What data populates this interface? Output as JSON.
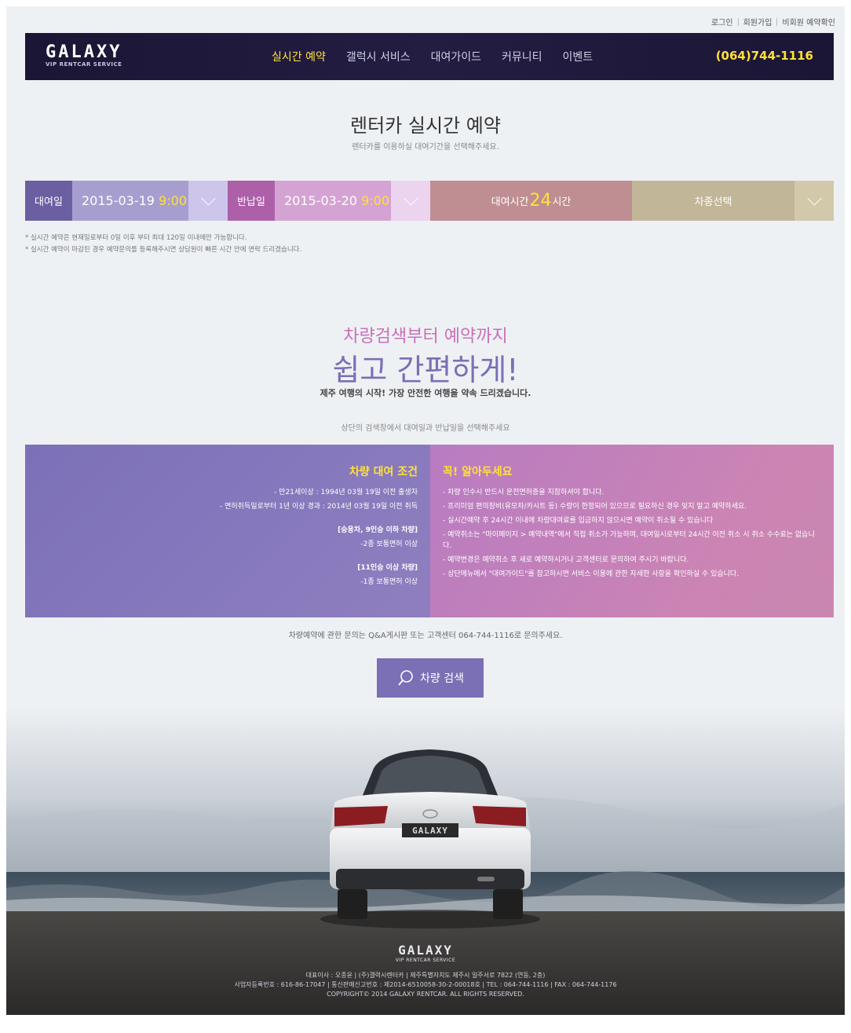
{
  "top_links": [
    "로그인",
    "회원가입",
    "비회원 예약확인"
  ],
  "brand": {
    "name": "GALAXY",
    "sub": "VIP RENTCAR SERVICE"
  },
  "nav": [
    "실시간 예약",
    "갤럭시 서비스",
    "대여가이드",
    "커뮤니티",
    "이벤트"
  ],
  "nav_active_index": 0,
  "phone": "(064)744-1116",
  "reserve": {
    "title": "렌터카 실시간 예약",
    "subtitle": "렌터카를 이용하실 대여기간을 선택해주세요."
  },
  "search": {
    "rental_label": "대여일",
    "rental_date": "2015-03-19",
    "rental_time": "9:00",
    "return_label": "반납일",
    "return_date": "2015-03-20",
    "return_time": "9:00",
    "duration_prefix": "대여시간",
    "duration_hours": "24",
    "duration_suffix": "시간",
    "car_type_label": "차종선택"
  },
  "notes": [
    "* 실시간 예약은 현재일로부터 0일 이후 부터 최대 120일 이내에만 가능합니다.",
    "* 실시간 예약이 마감된 경우 예약문의를 등록해주시면 상담원이 빠른 시간 안에 연락 드리겠습니다."
  ],
  "promo": {
    "line1": "차량검색부터 예약까지",
    "line2": "쉽고 간편하게!",
    "line3": "제주 여행의 시작! 가장 안전한 여행을 약속 드리겠습니다.",
    "line4": "상단의 검색창에서 대여일과 반납일을 선택해주세요"
  },
  "conditions": {
    "title": "차량 대여 조건",
    "items": [
      "- 만21세이상 : 1994년 03월 19일 이전 출생자",
      "- 면허취득일로부터 1년 이상 경과 : 2014년 03월 19일 이전 취득"
    ],
    "group1_title": "[승용차, 9인승 이하 차량]",
    "group1_item": "-2종 보통면허 이상",
    "group2_title": "[11인승 이상 차량]",
    "group2_item": "-1종 보통면허 이상"
  },
  "notice": {
    "title": "꼭! 알아두세요",
    "items": [
      "- 차량 인수시 반드시 운전면허증을 지참하셔야 합니다.",
      "- 프리미엄 편의장비(유모차/카시트 등) 수량이 한정되어 있으므로 필요하신 경우 잊지 말고 예약하세요.",
      "- 실시간예약 후 24시간 이내에 차량대여료를 입금하지 않으시면 예약이 취소될 수 있습니다",
      "- 예약취소는 \"마이페이지 > 예약내역\"에서 직접 취소가 가능하며, 대여일시로부터 24시간 이전 취소 시 취소 수수료는 없습니다.",
      "- 예약변경은 예약취소 후 새로 예약하시거나 고객센터로 문의하여 주시기 바랍니다.",
      "- 상단메뉴에서 \"대여가이드\"를 참고하시면 서비스 이용에 관한 자세한 사항을 확인하실 수 있습니다."
    ]
  },
  "inquiry": "차량예약에 관한 문의는 Q&A게시판 또는 고객센터 064-744-1116로 문의주세요.",
  "search_button": "차량 검색",
  "car_plate": "GALAXY",
  "footer": {
    "name": "GALAXY",
    "sub": "VIP RENTCAR SERVICE",
    "line1": "대표이사 : 오종윤 | (주)갤럭시렌터카 | 제주특별자치도 제주시 일주서로 7822 (연동, 2층)",
    "line2": "사업자등록번호 : 616-86-17047 | 통신판매신고번호 : 제2014-6510058-30-2-00018호 | TEL : 064-744-1116 | FAX : 064-744-1176",
    "line3": "COPYRIGHT© 2014 GALAXY RENTCAR. ALL RIGHTS RESERVED."
  },
  "colors": {
    "accent": "#7b6fb5",
    "highlight": "#ffe13a",
    "pink": "#c870b8",
    "navbar": "#1b1635"
  }
}
